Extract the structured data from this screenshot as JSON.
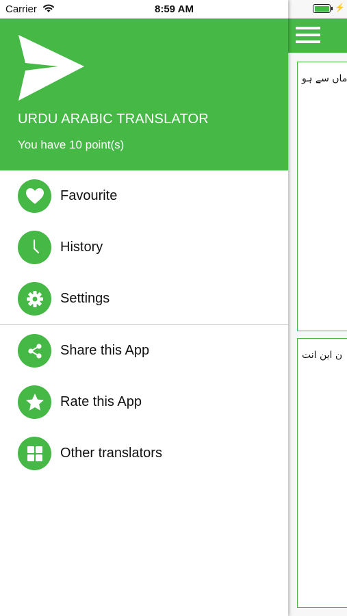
{
  "status_bar": {
    "carrier": "Carrier",
    "time": "8:59 AM"
  },
  "drawer": {
    "header": {
      "app_title": "URDU ARABIC TRANSLATOR",
      "points_text": "You have 10 point(s)"
    },
    "menu_primary": [
      {
        "label": "Favourite",
        "icon": "heart-icon"
      },
      {
        "label": "History",
        "icon": "clock-icon"
      },
      {
        "label": "Settings",
        "icon": "gear-icon"
      }
    ],
    "menu_secondary": [
      {
        "label": "Share this App",
        "icon": "share-icon"
      },
      {
        "label": "Rate this App",
        "icon": "star-icon"
      },
      {
        "label": "Other translators",
        "icon": "grid-icon"
      }
    ]
  },
  "main": {
    "source_text": "ماں سے ہو",
    "target_text": "ن این انت"
  },
  "colors": {
    "accent": "#45b845",
    "divider": "#c9c9c9"
  }
}
